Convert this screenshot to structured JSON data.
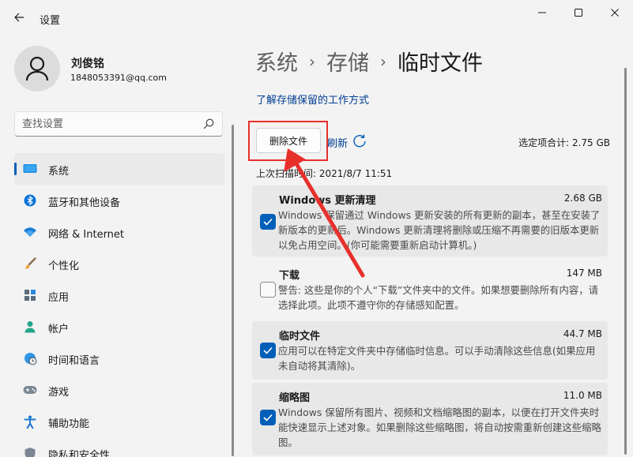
{
  "window": {
    "title": "设置",
    "back_icon": "arrow-left-icon",
    "minimize_icon": "minimize-icon",
    "maximize_icon": "maximize-icon",
    "close_icon": "close-icon"
  },
  "profile": {
    "name": "刘俊铭",
    "email": "1848053391@qq.com",
    "avatar_icon": "user-icon"
  },
  "search": {
    "placeholder": "查找设置",
    "icon": "search-icon"
  },
  "nav": {
    "items": [
      {
        "label": "系统",
        "icon": "monitor-icon",
        "active": true
      },
      {
        "label": "蓝牙和其他设备",
        "icon": "bluetooth-icon",
        "active": false
      },
      {
        "label": "网络 & Internet",
        "icon": "wifi-icon",
        "active": false
      },
      {
        "label": "个性化",
        "icon": "brush-icon",
        "active": false
      },
      {
        "label": "应用",
        "icon": "apps-icon",
        "active": false
      },
      {
        "label": "帐户",
        "icon": "account-icon",
        "active": false
      },
      {
        "label": "时间和语言",
        "icon": "globe-clock-icon",
        "active": false
      },
      {
        "label": "游戏",
        "icon": "gamepad-icon",
        "active": false
      },
      {
        "label": "辅助功能",
        "icon": "accessibility-icon",
        "active": false
      },
      {
        "label": "隐私和安全性",
        "icon": "shield-icon",
        "active": false
      }
    ]
  },
  "breadcrumb": {
    "level1": "系统",
    "level2": "存储",
    "current": "临时文件",
    "separator": "›"
  },
  "main": {
    "learn_link": "了解存储保留的工作方式",
    "delete_button": "删除文件",
    "refresh_label": "刷新",
    "selected_total": "选定项合计: 2.75 GB",
    "last_scan": "上次扫描时间: 2021/8/7 11:51"
  },
  "items": [
    {
      "title": "Windows 更新清理",
      "size": "2.68 GB",
      "checked": true,
      "desc": "Windows 保留通过 Windows 更新安装的所有更新的副本，甚至在安装了新版本的更新后。Windows 更新清理将删除或压缩不再需要的旧版本更新以免占用空间。(你可能需要重新启动计算机。)"
    },
    {
      "title": "下载",
      "size": "147 MB",
      "checked": false,
      "desc": "警告: 这些是你的个人“下载”文件夹中的文件。如果想要删除所有内容，请选择此项。此项不遵守你的存储感知配置。"
    },
    {
      "title": "临时文件",
      "size": "44.7 MB",
      "checked": true,
      "desc": "应用可以在特定文件夹中存储临时信息。可以手动清除这些信息(如果应用未自动将其清除)。"
    },
    {
      "title": "缩略图",
      "size": "11.0 MB",
      "checked": true,
      "desc": "Windows 保留所有图片、视频和文档缩略图的副本，以便在打开文件夹时能快速显示上述对象。如果删除这些缩略图，将自动按需重新创建这些缩略图。"
    }
  ],
  "colors": {
    "accent": "#005fb8",
    "link": "#003e92",
    "annotation": "#e8302b"
  }
}
